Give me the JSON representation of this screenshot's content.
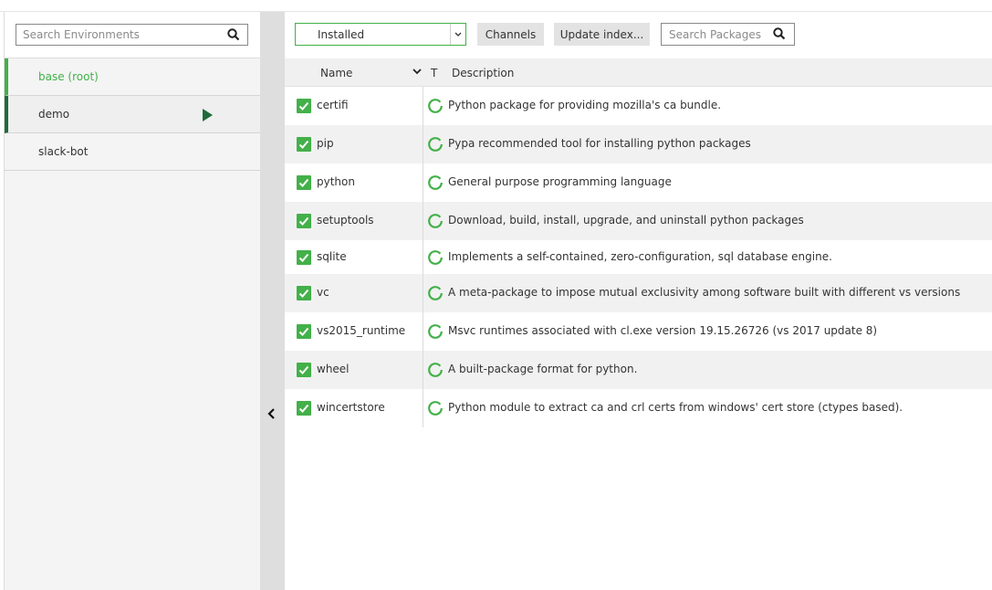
{
  "environments": {
    "search_placeholder": "Search Environments",
    "items": [
      {
        "name": "base (root)"
      },
      {
        "name": "demo"
      },
      {
        "name": "slack-bot"
      }
    ]
  },
  "toolbar": {
    "filter_value": "Installed",
    "channels_label": "Channels",
    "update_index_label": "Update index...",
    "search_placeholder": "Search Packages"
  },
  "table": {
    "col_name": "Name",
    "col_type": "T",
    "col_description": "Description",
    "rows": [
      {
        "name": "certifi",
        "description": "Python package for providing mozilla's ca bundle."
      },
      {
        "name": "pip",
        "description": "Pypa recommended tool for installing python packages"
      },
      {
        "name": "python",
        "description": "General purpose programming language"
      },
      {
        "name": "setuptools",
        "description": "Download, build, install, upgrade, and uninstall python packages"
      },
      {
        "name": "sqlite",
        "description": "Implements a self-contained, zero-configuration, sql database engine."
      },
      {
        "name": "vc",
        "description": "A meta-package to impose mutual exclusivity among software built with different vs versions"
      },
      {
        "name": "vs2015_runtime",
        "description": "Msvc runtimes associated with cl.exe version 19.15.26726 (vs 2017 update 8)"
      },
      {
        "name": "wheel",
        "description": "A built-package format for python."
      },
      {
        "name": "wincertstore",
        "description": "Python module to extract ca and crl certs from windows' cert store (ctypes based)."
      }
    ]
  },
  "colors": {
    "accent": "#43b049",
    "running": "#1f6b3a"
  }
}
